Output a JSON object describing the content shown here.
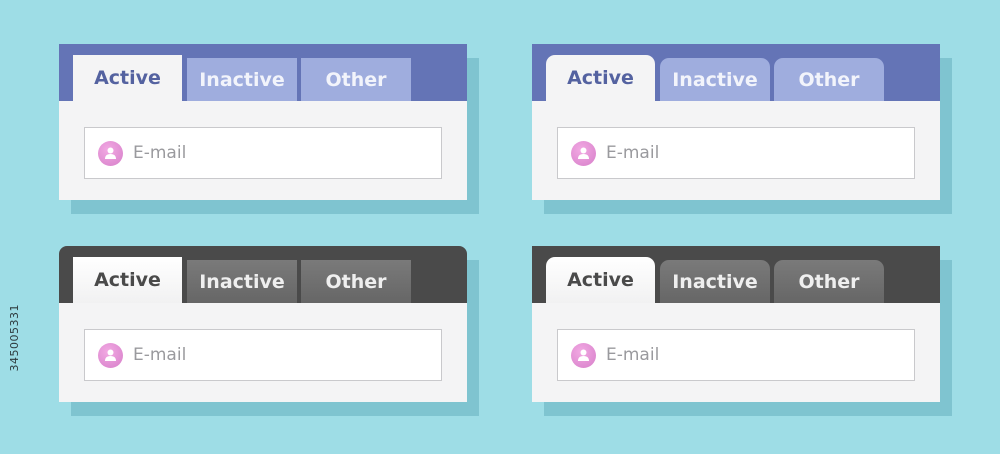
{
  "widgets": [
    {
      "tabs": {
        "active": "Active",
        "inactive": "Inactive",
        "other": "Other"
      },
      "field": {
        "placeholder": "E-mail"
      }
    },
    {
      "tabs": {
        "active": "Active",
        "inactive": "Inactive",
        "other": "Other"
      },
      "field": {
        "placeholder": "E-mail"
      }
    },
    {
      "tabs": {
        "active": "Active",
        "inactive": "Inactive",
        "other": "Other"
      },
      "field": {
        "placeholder": "E-mail"
      }
    },
    {
      "tabs": {
        "active": "Active",
        "inactive": "Inactive",
        "other": "Other"
      },
      "field": {
        "placeholder": "E-mail"
      }
    }
  ],
  "watermark": "345005331",
  "colors": {
    "background": "#9edde6",
    "blue_bar": "#6474b6",
    "blue_inactive_tab": "#9fadde",
    "dark_bar": "#4a4a4a",
    "dark_inactive_tab": "#6e6e6e",
    "avatar": "#e49ad8"
  },
  "icons": {
    "field_icon": "user-avatar-icon"
  }
}
